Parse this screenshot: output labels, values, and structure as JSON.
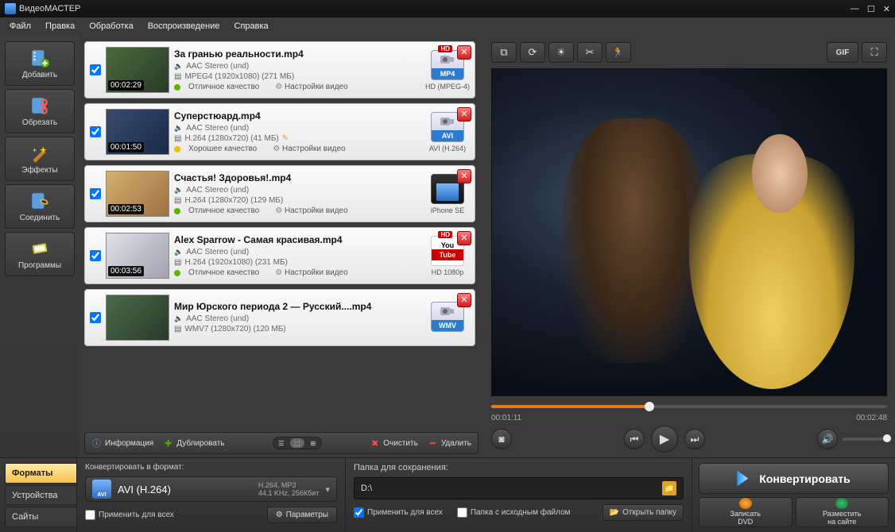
{
  "app": {
    "title": "ВидеоМАСТЕР"
  },
  "menu": [
    "Файл",
    "Правка",
    "Обработка",
    "Воспроизведение",
    "Справка"
  ],
  "sidebar": [
    {
      "label": "Добавить",
      "icon": "add-film-icon"
    },
    {
      "label": "Обрезать",
      "icon": "cut-film-icon"
    },
    {
      "label": "Эффекты",
      "icon": "effects-icon"
    },
    {
      "label": "Соединить",
      "icon": "join-film-icon"
    },
    {
      "label": "Программы",
      "icon": "programs-icon"
    }
  ],
  "files": [
    {
      "name": "За гранью реальности.mp4",
      "duration": "00:02:29",
      "audio": "AAC Stereo (und)",
      "video": "MPEG4 (1920x1080) (271 МБ)",
      "quality": "Отличное качество",
      "qdot": "green",
      "format_badge": "MP4",
      "badge_color": "#2b7cd0",
      "right_text": "HD (MPEG-4)",
      "hd": true
    },
    {
      "name": "Суперстюард.mp4",
      "duration": "00:01:50",
      "audio": "AAC Stereo (und)",
      "video": "H.264 (1280x720) (41 МБ)",
      "quality": "Хорошее качество",
      "qdot": "yellow",
      "format_badge": "AVI",
      "badge_color": "#2b7cd0",
      "right_text": "AVI (H.264)",
      "hd": false
    },
    {
      "name": "Счастья! Здоровья!.mp4",
      "duration": "00:02:53",
      "audio": "AAC Stereo (und)",
      "video": "H.264 (1280x720) (129 МБ)",
      "quality": "Отличное качество",
      "qdot": "green",
      "format_badge": "",
      "badge_color": "#ffffff",
      "right_text": "iPhone SE",
      "hd": false,
      "phone": true
    },
    {
      "name": "Alex Sparrow - Самая красивая.mp4",
      "duration": "00:03:56",
      "audio": "AAC Stereo (und)",
      "video": "H.264 (1920x1080) (231 МБ)",
      "quality": "Отличное качество",
      "qdot": "green",
      "format_badge": "YouTube",
      "badge_color": "#ffffff",
      "right_text": "HD 1080p",
      "hd": true,
      "yt": true
    },
    {
      "name": "Мир Юрского периода 2 — Русский....mp4",
      "duration": "",
      "audio": "AAC Stereo (und)",
      "video": "WMV7 (1280x720) (120 МБ)",
      "quality": "",
      "qdot": "",
      "format_badge": "WMV",
      "badge_color": "#2b7cd0",
      "right_text": "",
      "hd": false
    }
  ],
  "settings_label": "Настройки видео",
  "filetools": {
    "info": "Информация",
    "dup": "Дублировать",
    "clear": "Очистить",
    "delete": "Удалить"
  },
  "player": {
    "current": "00:01:11",
    "total": "00:02:48",
    "progress_pct": 40
  },
  "bottom": {
    "tabs": [
      "Форматы",
      "Устройства",
      "Сайты"
    ],
    "convert_to": "Конвертировать в формат:",
    "format_name": "AVI (H.264)",
    "format_icon_text": "AVI",
    "format_detail1": "H.264, MP3",
    "format_detail2": "44,1 KHz, 256Кбит",
    "apply_all": "Применить для всех",
    "params": "Параметры",
    "folder_label": "Папка для сохранения:",
    "folder_path": "D:\\",
    "apply_all2": "Применить для всех",
    "same_folder": "Папка с исходным файлом",
    "open_folder": "Открыть папку",
    "convert": "Конвертировать",
    "burn_dvd": "Записать\nDVD",
    "publish": "Разместить\nна сайте"
  }
}
